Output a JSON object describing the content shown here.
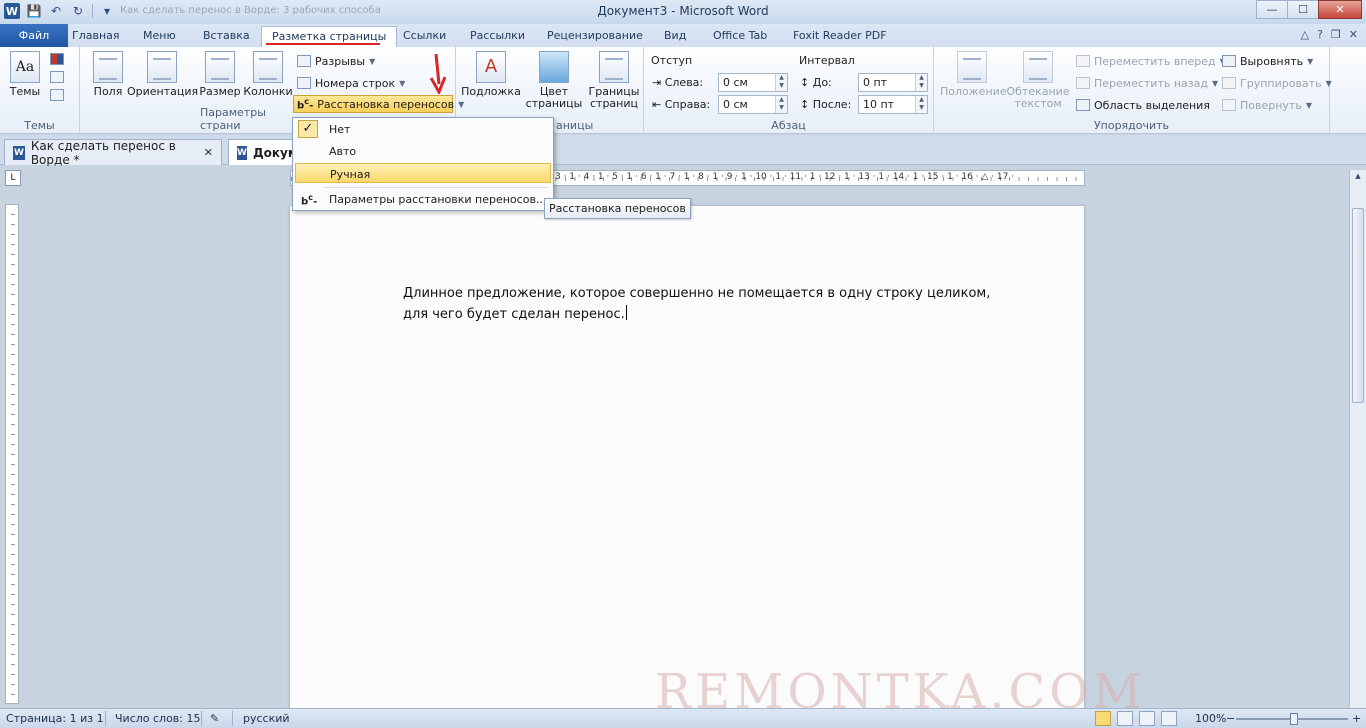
{
  "window": {
    "title": "Документ3 - Microsoft Word",
    "faint_title": "Как сделать перенос в Ворде: 3 рабочих способа",
    "controls": {
      "minimize": "—",
      "maximize": "☐",
      "close": "✕"
    }
  },
  "quick_access": {
    "logo": "W",
    "save": "💾",
    "undo": "↶",
    "repeat": "↻",
    "customize": "▾"
  },
  "tabs": [
    {
      "label": "Файл"
    },
    {
      "label": "Главная"
    },
    {
      "label": "Меню"
    },
    {
      "label": "Вставка"
    },
    {
      "label": "Разметка страницы"
    },
    {
      "label": "Ссылки"
    },
    {
      "label": "Рассылки"
    },
    {
      "label": "Рецензирование"
    },
    {
      "label": "Вид"
    },
    {
      "label": "Office Tab"
    },
    {
      "label": "Foxit Reader PDF"
    }
  ],
  "ribbon": {
    "themes": {
      "btn": "Темы",
      "group": "Темы",
      "icon": "Aa"
    },
    "page_setup": {
      "fields": "Поля",
      "orientation": "Ориентация",
      "size": "Размер",
      "columns": "Колонки",
      "breaks": "Разрывы",
      "line_numbers": "Номера строк",
      "hyphenation": "Расстановка переносов",
      "group": "Параметры страни"
    },
    "page_background": {
      "watermark": "Подложка",
      "color_1": "Цвет",
      "color_2": "страницы",
      "borders_1": "Границы",
      "borders_2": "страниц",
      "group": "аницы"
    },
    "paragraph": {
      "indent": "Отступ",
      "left": "Слева:",
      "left_val": "0 см",
      "right": "Справа:",
      "right_val": "0 см",
      "spacing": "Интервал",
      "before": "До:",
      "before_val": "0 пт",
      "after": "После:",
      "after_val": "10 пт",
      "group": "Абзац"
    },
    "arrange": {
      "position": "Положение",
      "wrap_1": "Обтекание",
      "wrap_2": "текстом",
      "forward": "Переместить вперед",
      "backward": "Переместить назад",
      "selection": "Область выделения",
      "align": "Выровнять",
      "group_btn": "Группировать",
      "rotate": "Повернуть",
      "group": "Упорядочить"
    }
  },
  "hyphen_menu": {
    "items": [
      {
        "label": "Нет",
        "check": "✓"
      },
      {
        "label": "Авто"
      },
      {
        "label": "Ручная"
      }
    ],
    "options": "Параметры расстановки переносов...",
    "tooltip": "Расстановка переносов"
  },
  "doc_tabs": [
    {
      "label": "Как сделать перенос в Ворде *",
      "close": "✕"
    },
    {
      "label": "Докум"
    }
  ],
  "ruler": {
    "corner": "L",
    "numbers": "3 · 1 · 4 · 1 · 5 · 1 · 6 · 1 · 7 · 1 · 8 · 1 · 9 · 1 · 10 · 1 · 11 · 1 · 12 · 1 · 13 · 1 · 14 · 1 · 15 · 1 · 16 · △ · 17 ·"
  },
  "document": {
    "text": "Длинное предложение, которое совершенно не помещается в одну строку целиком, для чего будет сделан перенос."
  },
  "status": {
    "page": "Страница: 1 из 1",
    "words": "Число слов: 15",
    "lang": "русский",
    "zoom": "100%",
    "minus": "−",
    "plus": "+"
  },
  "watermark_text": "REMONTKA.COM",
  "help": {
    "caret": "△",
    "help": "?",
    "restore": "❐",
    "close": "✕"
  }
}
